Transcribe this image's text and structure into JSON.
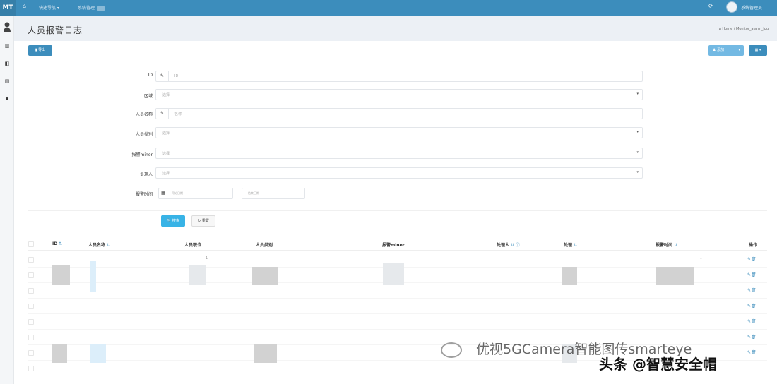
{
  "topbar": {
    "logo": "MT",
    "home_icon": "home-icon",
    "menu1": "快速导航 ▾",
    "menu2": "系统管理",
    "refresh_icon": "refresh-icon",
    "user": "系统管理员"
  },
  "sidebar": {
    "icons": [
      "dashboard-icon",
      "log-icon",
      "book-icon",
      "user-icon"
    ]
  },
  "header": {
    "title": "人员报警日志",
    "breadcrumb": "Home  /  Monitor_alarm_log"
  },
  "toolbar": {
    "export": "▮ 导出",
    "add": "添加",
    "columns": "▦ ▾"
  },
  "form": {
    "fields": [
      {
        "label": "ID",
        "type": "text",
        "placeholder": "ID"
      },
      {
        "label": "区域",
        "type": "select",
        "placeholder": "选择"
      },
      {
        "label": "人员名称",
        "type": "text",
        "placeholder": "名称"
      },
      {
        "label": "人员类别",
        "type": "select",
        "placeholder": "选择"
      },
      {
        "label": "报警minor",
        "type": "select",
        "placeholder": "选择"
      },
      {
        "label": "处理人",
        "type": "select",
        "placeholder": "选择"
      },
      {
        "label": "报警时间",
        "type": "daterange",
        "start_placeholder": "开始日期",
        "end_placeholder": "结束日期"
      }
    ],
    "search_label": "🔍 搜索",
    "reset_label": "↻ 重置"
  },
  "table": {
    "columns": [
      "ID",
      "人员名称",
      "人员职位",
      "人员类别",
      "报警minor",
      "处理人",
      "处理",
      "报警时间",
      "操作"
    ],
    "row_count": 8,
    "ops": "✎🗑"
  },
  "watermark": {
    "line1": "优视5GCamera智能图传smarteye",
    "line2": "头条 @智慧安全帽"
  }
}
